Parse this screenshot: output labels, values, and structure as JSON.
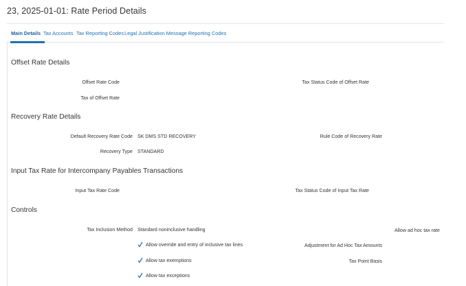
{
  "page": {
    "title": "23, 2025-01-01: Rate Period Details"
  },
  "tabs": [
    {
      "label": "Main Details"
    },
    {
      "label": "Tax Accounts"
    },
    {
      "label": "Tax Reporting Codes"
    },
    {
      "label": "Legal Justification Message Reporting Codes"
    }
  ],
  "offset": {
    "heading": "Offset Rate Details",
    "offset_rate_code_label": "Offset Rate Code",
    "tax_status_code_label": "Tax Status Code of Offset Rate",
    "tax_of_offset_rate_label": "Tax of Offset Rate"
  },
  "recovery": {
    "heading": "Recovery Rate Details",
    "default_recovery_rate_code_label": "Default Recovery Rate Code",
    "default_recovery_rate_code_value": "SK DMS STD RECOVERY",
    "rule_code_label": "Rule Code of Recovery Rate",
    "recovery_type_label": "Recovery Type",
    "recovery_type_value": "STANDARD"
  },
  "intercompany": {
    "heading": "Input Tax Rate for Intercompany Payables Transactions",
    "input_tax_rate_code_label": "Input Tax Rate Code",
    "tax_status_code_input_label": "Tax Status Code of Input Tax Rate"
  },
  "controls": {
    "heading": "Controls",
    "tax_inclusion_method_label": "Tax Inclusion Method",
    "tax_inclusion_method_value": "Standard noninclusive handling",
    "allow_ad_hoc_label": "Allow ad hoc tax rate",
    "allow_override_label": "Allow override and entry of inclusive tax lines",
    "adjustment_ad_hoc_label": "Adjustment for Ad Hoc Tax Amounts",
    "allow_exemptions_label": "Allow tax exemptions",
    "tax_point_basis_label": "Tax Point Basis",
    "allow_exceptions_label": "Allow tax exceptions"
  },
  "colors": {
    "link": "#1f6fb2",
    "check": "#2a6fb5",
    "border": "#e4e4e4"
  }
}
